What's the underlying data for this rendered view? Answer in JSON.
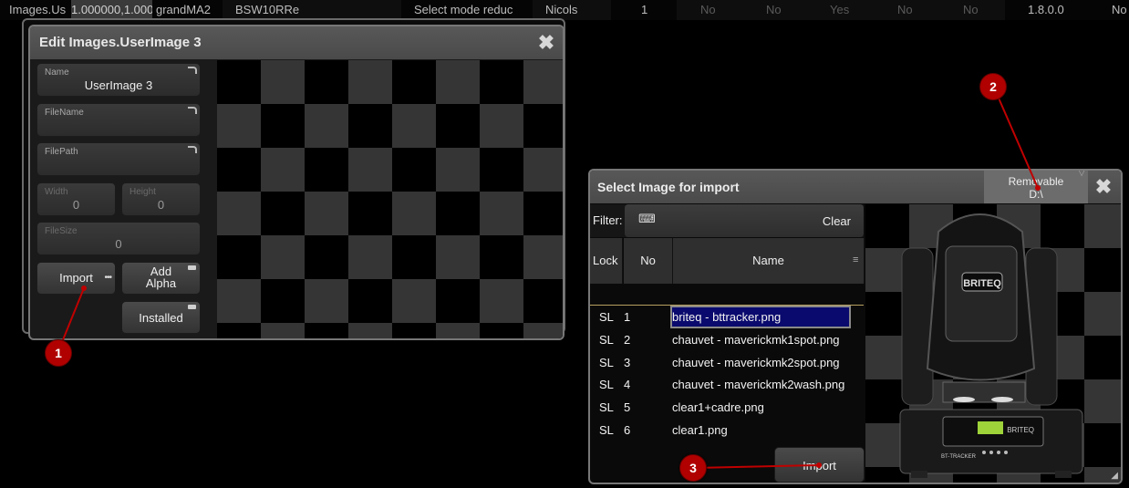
{
  "top_row": {
    "c1": "Images.Us",
    "c2": "1.000000,1.000",
    "c3": "grandMA2",
    "c4": "BSW10RRe",
    "c5": "Select mode reduc",
    "c6": "Nicols",
    "c7": "1",
    "c8": "No",
    "c9": "No",
    "c10": "Yes",
    "c11": "No",
    "c12": "No",
    "c13": "1.8.0.0",
    "c14": "No"
  },
  "edit_dialog": {
    "title": "Edit Images.UserImage 3",
    "name_label": "Name",
    "name_value": "UserImage 3",
    "filename_label": "FileName",
    "filepath_label": "FilePath",
    "width_label": "Width",
    "width_value": "0",
    "height_label": "Height",
    "height_value": "0",
    "filesize_label": "FileSize",
    "filesize_value": "0",
    "import_button": "Import",
    "add_alpha_button": "Add\nAlpha",
    "installed_button": "Installed"
  },
  "select_dialog": {
    "title": "Select Image for import",
    "removable_label": "Removable\nD:\\",
    "filter_label": "Filter:",
    "clear_button": "Clear",
    "columns": {
      "lock": "Lock",
      "no": "No",
      "name": "Name"
    },
    "rows": [
      {
        "lock": "SL",
        "no": "1",
        "name": "briteq - bttracker.png"
      },
      {
        "lock": "SL",
        "no": "2",
        "name": "chauvet - maverickmk1spot.png"
      },
      {
        "lock": "SL",
        "no": "3",
        "name": "chauvet - maverickmk2spot.png"
      },
      {
        "lock": "SL",
        "no": "4",
        "name": "chauvet - maverickmk2wash.png"
      },
      {
        "lock": "SL",
        "no": "5",
        "name": "clear1+cadre.png"
      },
      {
        "lock": "SL",
        "no": "6",
        "name": "clear1.png"
      }
    ],
    "import_button": "Import",
    "preview_brand": "BRITEQ",
    "preview_model": "BT-TRACKER"
  },
  "markers": [
    "1",
    "2",
    "3"
  ],
  "colors": {
    "selected_row": "#0a0a6e",
    "marker": "#b00000",
    "selected_row_border": "#8a8a8a"
  }
}
